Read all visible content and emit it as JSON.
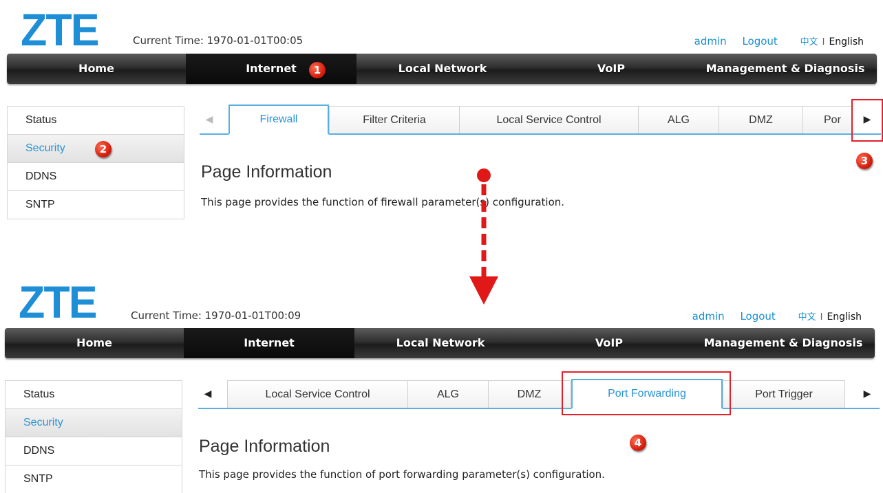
{
  "brand": {
    "logo": "ZTE",
    "logo_color": "#1e8fd6"
  },
  "user_bar": {
    "user": "admin",
    "logout": "Logout",
    "lang_cn": "中文",
    "separator": "I",
    "lang_en": "English"
  },
  "nav": [
    "Home",
    "Internet",
    "Local Network",
    "VoIP",
    "Management & Diagnosis"
  ],
  "sidebar": [
    "Status",
    "Security",
    "DDNS",
    "SNTP"
  ],
  "top": {
    "current_time": "Current Time: 1970-01-01T00:05",
    "tabs": [
      "Firewall",
      "Filter Criteria",
      "Local Service Control",
      "ALG",
      "DMZ",
      "Por"
    ],
    "active_tab": "Firewall",
    "page_info_title": "Page Information",
    "page_info_desc": "This page provides the function of firewall parameter(s) configuration."
  },
  "bottom": {
    "current_time": "Current Time: 1970-01-01T00:09",
    "tabs": [
      "Local Service Control",
      "ALG",
      "DMZ",
      "Port Forwarding",
      "Port Trigger"
    ],
    "active_tab": "Port Forwarding",
    "page_info_title": "Page Information",
    "page_info_desc": "This page provides the function of port forwarding parameter(s) configuration."
  },
  "arrows": {
    "left": "◀",
    "right": "▶"
  },
  "callouts": [
    "1",
    "2",
    "3",
    "4"
  ],
  "colors": {
    "accent": "#2a93d5",
    "callout": "#d21c0c",
    "highlight": "#e0202a",
    "navbar": "#2f2f2f"
  }
}
